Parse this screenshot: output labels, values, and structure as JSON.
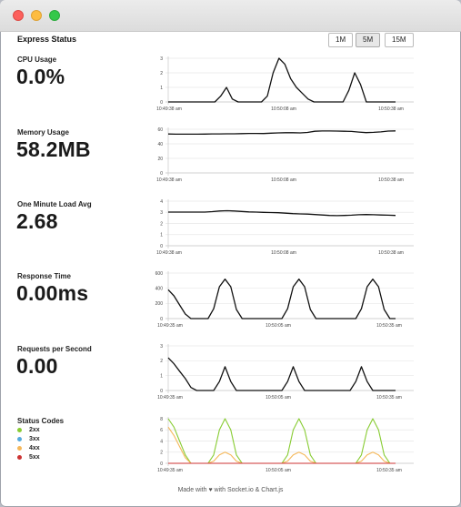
{
  "header": {
    "title": "Express Status"
  },
  "span_buttons": [
    {
      "label": "1M",
      "active": false
    },
    {
      "label": "5M",
      "active": true
    },
    {
      "label": "15M",
      "active": false
    }
  ],
  "metrics": {
    "cpu": {
      "label": "CPU Usage",
      "value": "0.0%"
    },
    "memory": {
      "label": "Memory Usage",
      "value": "58.2MB"
    },
    "load": {
      "label": "One Minute Load Avg",
      "value": "2.68"
    },
    "response": {
      "label": "Response Time",
      "value": "0.00ms"
    },
    "rps": {
      "label": "Requests per Second",
      "value": "0.00"
    },
    "status": {
      "label": "Status Codes"
    }
  },
  "status_legend": [
    {
      "label": "2xx",
      "color": "#88cc33"
    },
    {
      "label": "3xx",
      "color": "#55aadd"
    },
    {
      "label": "4xx",
      "color": "#f5b85a"
    },
    {
      "label": "5xx",
      "color": "#cc3333"
    }
  ],
  "footer": {
    "before": "Made with",
    "heart": "♥",
    "after": "with Socket.io & Chart.js"
  },
  "chart_data": [
    {
      "id": "cpu",
      "type": "line",
      "x": [
        "10:49:38 am",
        "10:50:08 am",
        "10:50:38 am"
      ],
      "yticks": [
        0,
        1,
        2,
        3
      ],
      "ylim": [
        0,
        3
      ],
      "series": [
        {
          "color": "#111111",
          "values": [
            0,
            0,
            0,
            0,
            0,
            0,
            0,
            0,
            0,
            0.4,
            1.0,
            0.2,
            0,
            0,
            0,
            0,
            0,
            0.4,
            2.0,
            3.0,
            2.6,
            1.6,
            1.0,
            0.6,
            0.2,
            0,
            0,
            0,
            0,
            0,
            0,
            0.8,
            2.0,
            1.2,
            0,
            0,
            0,
            0,
            0,
            0
          ]
        }
      ]
    },
    {
      "id": "memory",
      "type": "line",
      "x": [
        "10:49:38 am",
        "10:50:08 am",
        "10:50:38 am"
      ],
      "yticks": [
        0,
        20,
        40,
        60
      ],
      "ylim": [
        0,
        60
      ],
      "series": [
        {
          "color": "#111111",
          "values": [
            53.5,
            53.3,
            53.2,
            53.2,
            53.3,
            53.4,
            53.6,
            53.6,
            53.7,
            53.8,
            54.0,
            54.2,
            54.3,
            54.1,
            54.6,
            55.0,
            55.2,
            55.3,
            55.0,
            55.6,
            57.2,
            57.6,
            57.6,
            57.5,
            57.3,
            57.0,
            56.1,
            55.4,
            55.8,
            56.4,
            57.5,
            57.8
          ]
        }
      ]
    },
    {
      "id": "load",
      "type": "line",
      "x": [
        "10:49:38 am",
        "10:50:08 am",
        "10:50:38 am"
      ],
      "yticks": [
        0,
        1,
        2,
        3,
        4
      ],
      "ylim": [
        0,
        4
      ],
      "series": [
        {
          "color": "#111111",
          "values": [
            3.02,
            3.02,
            3.02,
            3.02,
            3.02,
            3.02,
            3.06,
            3.12,
            3.14,
            3.12,
            3.08,
            3.04,
            3.02,
            3.0,
            2.98,
            2.96,
            2.92,
            2.88,
            2.86,
            2.84,
            2.8,
            2.76,
            2.72,
            2.7,
            2.72,
            2.74,
            2.78,
            2.8,
            2.78,
            2.76,
            2.74,
            2.72
          ]
        }
      ]
    },
    {
      "id": "response",
      "type": "line",
      "x": [
        "10:49:35 am",
        "10:50:05 am",
        "10:50:35 am"
      ],
      "yticks": [
        0,
        200,
        400,
        600
      ],
      "ylim": [
        0,
        600
      ],
      "series": [
        {
          "color": "#111111",
          "values": [
            380,
            300,
            180,
            60,
            0,
            0,
            0,
            0,
            130,
            420,
            520,
            420,
            120,
            0,
            0,
            0,
            0,
            0,
            0,
            0,
            0,
            130,
            420,
            520,
            420,
            120,
            0,
            0,
            0,
            0,
            0,
            0,
            0,
            0,
            130,
            420,
            520,
            420,
            120,
            0,
            0
          ]
        }
      ]
    },
    {
      "id": "rps",
      "type": "line",
      "x": [
        "10:49:35 am",
        "10:50:05 am",
        "10:50:35 am"
      ],
      "yticks": [
        0,
        1,
        2,
        3
      ],
      "ylim": [
        0,
        3
      ],
      "series": [
        {
          "color": "#111111",
          "values": [
            2.2,
            1.8,
            1.3,
            0.8,
            0.2,
            0,
            0,
            0,
            0,
            0.6,
            1.6,
            0.6,
            0,
            0,
            0,
            0,
            0,
            0,
            0,
            0,
            0,
            0.6,
            1.6,
            0.6,
            0,
            0,
            0,
            0,
            0,
            0,
            0,
            0,
            0,
            0.6,
            1.6,
            0.6,
            0,
            0,
            0,
            0,
            0
          ]
        }
      ]
    },
    {
      "id": "status",
      "type": "line",
      "x": [
        "10:49:35 am",
        "10:50:05 am",
        "10:50:35 am"
      ],
      "yticks": [
        0,
        2,
        4,
        6,
        8
      ],
      "ylim": [
        0,
        8
      ],
      "series": [
        {
          "label": "2xx",
          "color": "#88cc33",
          "values": [
            8,
            6.5,
            4,
            1.5,
            0,
            0,
            0,
            0,
            1.5,
            6,
            8,
            6,
            1.5,
            0,
            0,
            0,
            0,
            0,
            0,
            0,
            0,
            1.5,
            6,
            8,
            6,
            1.5,
            0,
            0,
            0,
            0,
            0,
            0,
            0,
            0,
            1.5,
            6,
            8,
            6,
            1.5,
            0,
            0
          ]
        },
        {
          "label": "3xx",
          "color": "#55aadd",
          "values": [
            0,
            0,
            0,
            0,
            0,
            0,
            0,
            0,
            0,
            0,
            0,
            0,
            0,
            0,
            0,
            0,
            0,
            0,
            0,
            0,
            0,
            0,
            0,
            0,
            0,
            0,
            0,
            0,
            0,
            0,
            0,
            0,
            0,
            0,
            0,
            0,
            0,
            0,
            0,
            0,
            0
          ]
        },
        {
          "label": "4xx",
          "color": "#f5b85a",
          "values": [
            6.5,
            5,
            3,
            1,
            0,
            0,
            0,
            0,
            0.4,
            1.5,
            2,
            1.5,
            0.4,
            0,
            0,
            0,
            0,
            0,
            0,
            0,
            0,
            0.4,
            1.5,
            2,
            1.5,
            0.4,
            0,
            0,
            0,
            0,
            0,
            0,
            0,
            0,
            0.4,
            1.5,
            2,
            1.5,
            0.4,
            0,
            0
          ]
        },
        {
          "label": "5xx",
          "color": "#cc3333",
          "values": [
            0,
            0,
            0,
            0,
            0,
            0,
            0,
            0,
            0,
            0,
            0,
            0,
            0,
            0,
            0,
            0,
            0,
            0,
            0,
            0,
            0,
            0,
            0,
            0,
            0,
            0,
            0,
            0,
            0,
            0,
            0,
            0,
            0,
            0,
            0,
            0,
            0,
            0,
            0,
            0,
            0
          ]
        }
      ]
    }
  ]
}
